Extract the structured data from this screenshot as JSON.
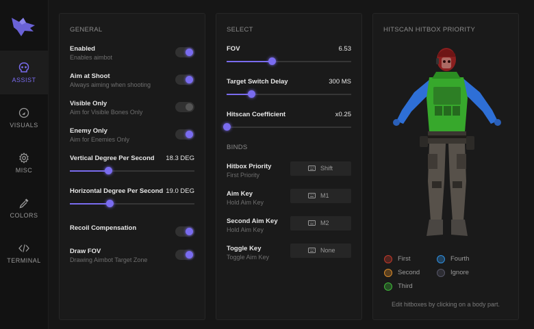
{
  "sidebar": {
    "logo_icon": "wolf-logo-icon",
    "items": [
      {
        "label": "ASSIST",
        "icon": "skull-icon",
        "active": true
      },
      {
        "label": "VISUALS",
        "icon": "eye-circle-icon",
        "active": false
      },
      {
        "label": "MISC",
        "icon": "gear-icon",
        "active": false
      },
      {
        "label": "COLORS",
        "icon": "eyedropper-icon",
        "active": false
      },
      {
        "label": "TERMINAL",
        "icon": "code-icon",
        "active": false
      }
    ]
  },
  "general": {
    "title": "GENERAL",
    "toggles": [
      {
        "title": "Enabled",
        "subtitle": "Enables aimbot",
        "on": true
      },
      {
        "title": "Aim at Shoot",
        "subtitle": "Always aiming when shooting",
        "on": true
      },
      {
        "title": "Visible Only",
        "subtitle": "Aim for Visible Bones Only",
        "on": false
      },
      {
        "title": "Enemy Only",
        "subtitle": "Aim for Enemies Only",
        "on": true
      }
    ],
    "sliders": [
      {
        "label": "Vertical Degree Per Second",
        "value": "18.3 DEG",
        "fraction": 0.31
      },
      {
        "label": "Horizontal Degree Per Second",
        "value": "19.0 DEG",
        "fraction": 0.32
      }
    ],
    "toggles2": [
      {
        "title": "Recoil Compensation",
        "subtitle": "",
        "on": true
      },
      {
        "title": "Draw FOV",
        "subtitle": "Drawing Aimbot Target Zone",
        "on": true
      }
    ]
  },
  "select": {
    "title": "SELECT",
    "sliders": [
      {
        "label": "FOV",
        "value": "6.53",
        "fraction": 0.36
      },
      {
        "label": "Target Switch Delay",
        "value": "300 MS",
        "fraction": 0.2
      },
      {
        "label": "Hitscan Coefficient",
        "value": "x0.25",
        "fraction": 0.0
      }
    ],
    "binds_title": "BINDS",
    "binds": [
      {
        "title": "Hitbox Priority",
        "subtitle": "First Priority",
        "key": "Shift"
      },
      {
        "title": "Aim Key",
        "subtitle": "Hold Aim Key",
        "key": "M1"
      },
      {
        "title": "Second Aim Key",
        "subtitle": "Hold Aim Key",
        "key": "M2"
      },
      {
        "title": "Toggle Key",
        "subtitle": "Toggle Aim Key",
        "key": "None"
      }
    ]
  },
  "hitbox": {
    "title": "HITSCAN HITBOX PRIORITY",
    "legend": [
      {
        "label": "First",
        "color": "#c0392b"
      },
      {
        "label": "Fourth",
        "color": "#2f8fe0"
      },
      {
        "label": "Second",
        "color": "#d98a2b"
      },
      {
        "label": "Ignore",
        "color": "#555566"
      },
      {
        "label": "Third",
        "color": "#3fb93a"
      }
    ],
    "footnote": "Edit hitboxes by clicking on a body part."
  }
}
